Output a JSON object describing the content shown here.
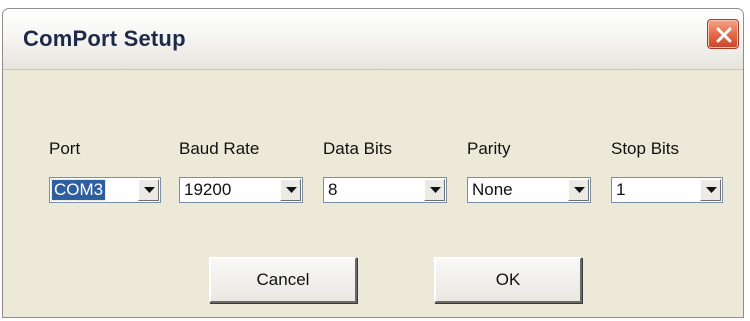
{
  "window": {
    "title": "ComPort Setup"
  },
  "fields": [
    {
      "label": "Port",
      "value": "COM3"
    },
    {
      "label": "Baud Rate",
      "value": "19200"
    },
    {
      "label": "Data Bits",
      "value": "8"
    },
    {
      "label": "Parity",
      "value": "None"
    },
    {
      "label": "Stop Bits",
      "value": "1"
    }
  ],
  "buttons": {
    "cancel_label": "Cancel",
    "ok_label": "OK"
  },
  "icons": {
    "close": "close-icon",
    "dropdown": "chevron-down-icon"
  },
  "colors": {
    "dialog_bg": "#ece9d8",
    "close_button": "#e56b4c",
    "selection": "#2f5e9e"
  }
}
